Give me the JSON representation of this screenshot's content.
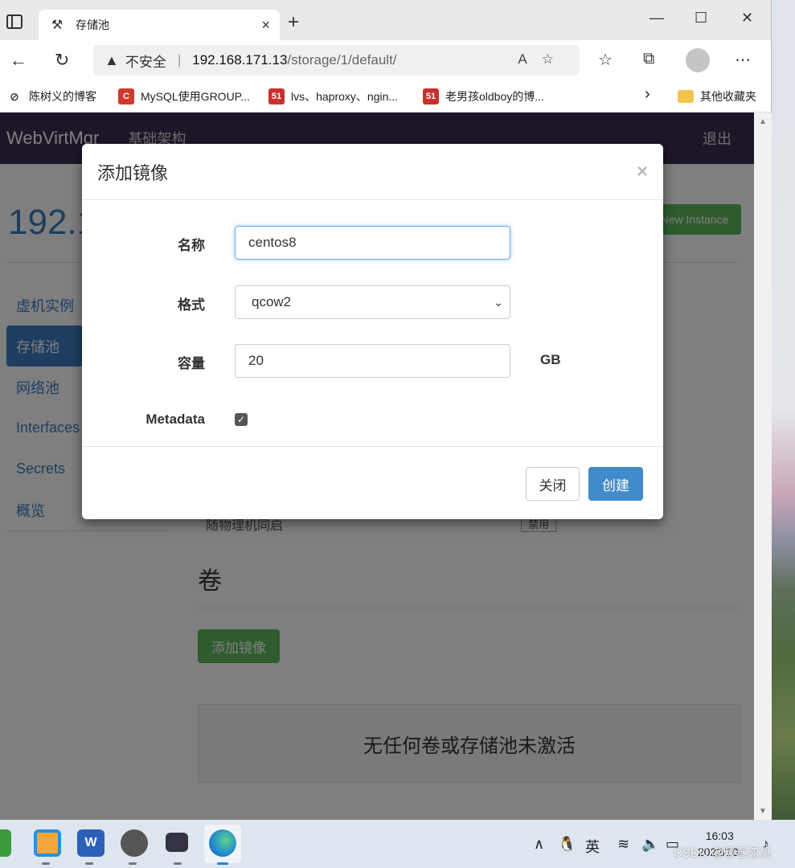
{
  "browser": {
    "tab_title": "存储池",
    "tab_close": "×",
    "new_tab": "+",
    "insecure_label": "不安全",
    "url_separator": "|",
    "url_host": "192.168.171.13",
    "url_path": "/storage/1/default/",
    "bookmarks": [
      {
        "label": "陈树义的博客"
      },
      {
        "label": "MySQL使用GROUP..."
      },
      {
        "label": "lvs、haproxy、ngin..."
      },
      {
        "label": "老男孩oldboy的博..."
      },
      {
        "label": "其他收藏夹"
      }
    ],
    "bookmark_more": "›",
    "window_controls": {
      "minimize": "—",
      "maximize": "☐",
      "close": "✕"
    }
  },
  "app": {
    "brand": "WebVirtMgr",
    "nav_link": "基础架构",
    "logout": "退出",
    "host_title": "192.1",
    "new_instance_btn": "New Instance",
    "side_menu": [
      {
        "label": "虚机实例"
      },
      {
        "label": "存储池"
      },
      {
        "label": "网络池"
      },
      {
        "label": "Interfaces"
      },
      {
        "label": "Secrets"
      },
      {
        "label": "概览"
      }
    ],
    "bg_row_text": "随物理机同启",
    "bg_badge": "禁用",
    "volumes_title": "卷",
    "add_image_btn": "添加镜像",
    "empty_message": "无任何卷或存储池未激活"
  },
  "modal": {
    "title": "添加镜像",
    "close_symbol": "×",
    "fields": {
      "name_label": "名称",
      "name_value": "centos8",
      "format_label": "格式",
      "format_value": "qcow2",
      "capacity_label": "容量",
      "capacity_value": "20",
      "capacity_unit": "GB",
      "metadata_label": "Metadata",
      "metadata_checked": true
    },
    "btn_close": "关闭",
    "btn_create": "创建"
  },
  "taskbar": {
    "ime": "英",
    "time": "16:03",
    "date": "2022/10/",
    "watermark": "CSDN @暖春忽见"
  },
  "colors": {
    "navbar": "#3b2d4f",
    "primary": "#428bca",
    "success": "#5cb85c",
    "link": "#3a7cc2"
  }
}
